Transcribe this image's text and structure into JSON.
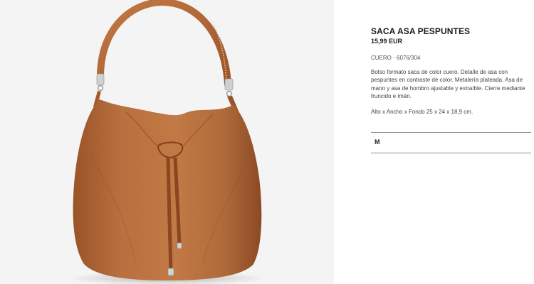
{
  "product": {
    "title": "SACA ASA PESPUNTES",
    "price": "15,99 EUR",
    "reference": "CUERO - 6076/304",
    "description": "Bolso formato saca de color cuero. Detalle de asa con pespuntes en contraste de color. Metalería plateada. Asa de mano y asa de hombro ajustable y extraíble. Cierre mediante fruncido e imán.",
    "dimensions": "Alto x Ancho x Fondo 25 x 24 x 18,9 cm.",
    "sizes": [
      "M"
    ],
    "selected_size": "M"
  },
  "image": {
    "background": "#f4f4f4",
    "bag_color": "#b46a3c",
    "hardware_color": "#c9c9c9"
  }
}
